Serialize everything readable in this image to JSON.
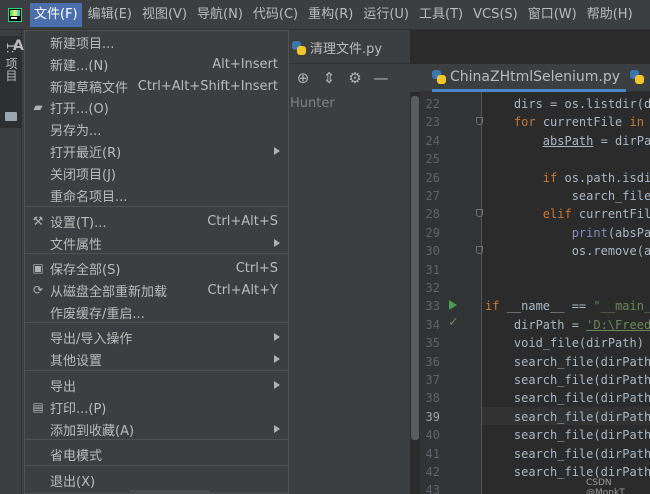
{
  "menubar": {
    "items": [
      "文件(F)",
      "编辑(E)",
      "视图(V)",
      "导航(N)",
      "代码(C)",
      "重构(R)",
      "运行(U)",
      "工具(T)",
      "VCS(S)",
      "窗口(W)",
      "帮助(H)"
    ],
    "active_index": 0
  },
  "toolwindow": {
    "strip_label": "1: 项目",
    "panel_title": "Ac",
    "tree_item": "Hunter"
  },
  "tabs": {
    "top_tab": "清理文件.py",
    "editor_tab": "ChinaZHtmlSelenium.py"
  },
  "file_menu": {
    "items": [
      {
        "label": "新建项目...",
        "shortcut": "",
        "submenu": false,
        "icon": ""
      },
      {
        "label": "新建...(N)",
        "shortcut": "Alt+Insert",
        "submenu": false,
        "icon": ""
      },
      {
        "label": "新建草稿文件",
        "shortcut": "Ctrl+Alt+Shift+Insert",
        "submenu": false,
        "icon": ""
      },
      {
        "label": "打开...(O)",
        "shortcut": "",
        "submenu": false,
        "icon": "folder-icon"
      },
      {
        "label": "另存为...",
        "shortcut": "",
        "submenu": false,
        "icon": ""
      },
      {
        "label": "打开最近(R)",
        "shortcut": "",
        "submenu": true,
        "icon": ""
      },
      {
        "label": "关闭项目(J)",
        "shortcut": "",
        "submenu": false,
        "icon": ""
      },
      {
        "label": "重命名项目...",
        "shortcut": "",
        "submenu": false,
        "icon": ""
      },
      {
        "label": "设置(T)...",
        "shortcut": "Ctrl+Alt+S",
        "submenu": false,
        "icon": "wrench-icon"
      },
      {
        "label": "文件属性",
        "shortcut": "",
        "submenu": true,
        "icon": ""
      },
      {
        "label": "保存全部(S)",
        "shortcut": "Ctrl+S",
        "submenu": false,
        "icon": "save-icon"
      },
      {
        "label": "从磁盘全部重新加载",
        "shortcut": "Ctrl+Alt+Y",
        "submenu": false,
        "icon": "reload-icon"
      },
      {
        "label": "作废缓存/重启...",
        "shortcut": "",
        "submenu": false,
        "icon": ""
      },
      {
        "label": "导出/导入操作",
        "shortcut": "",
        "submenu": true,
        "icon": ""
      },
      {
        "label": "其他设置",
        "shortcut": "",
        "submenu": true,
        "icon": ""
      },
      {
        "label": "导出",
        "shortcut": "",
        "submenu": true,
        "icon": ""
      },
      {
        "label": "打印...(P)",
        "shortcut": "",
        "submenu": false,
        "icon": "print-icon"
      },
      {
        "label": "添加到收藏(A)",
        "shortcut": "",
        "submenu": true,
        "icon": ""
      },
      {
        "label": "省电模式",
        "shortcut": "",
        "submenu": false,
        "icon": ""
      },
      {
        "label": "退出(X)",
        "shortcut": "",
        "submenu": false,
        "icon": ""
      }
    ]
  },
  "editor": {
    "line_numbers": [
      "22",
      "23",
      "24",
      "25",
      "26",
      "27",
      "28",
      "29",
      "30",
      "31",
      "32",
      "33",
      "34",
      "35",
      "36",
      "37",
      "38",
      "39",
      "40",
      "41",
      "42",
      "43"
    ],
    "current_line": "39",
    "lines": [
      {
        "indent": "    ",
        "segments": [
          [
            "",
            "dirs = os.listdir(di"
          ]
        ]
      },
      {
        "indent": "    ",
        "segments": [
          [
            "kw",
            "for "
          ],
          [
            "",
            "currentFile "
          ],
          [
            "kw",
            "in "
          ],
          [
            "",
            "c"
          ]
        ]
      },
      {
        "indent": "        ",
        "segments": [
          [
            "u",
            "absPath"
          ],
          [
            "",
            " = dirPat"
          ]
        ]
      },
      {
        "indent": "",
        "segments": [
          [
            "",
            ""
          ]
        ]
      },
      {
        "indent": "        ",
        "segments": [
          [
            "kw",
            "if "
          ],
          [
            "",
            "os.path.isdir"
          ]
        ]
      },
      {
        "indent": "            ",
        "segments": [
          [
            "",
            "search_file("
          ]
        ]
      },
      {
        "indent": "        ",
        "segments": [
          [
            "kw",
            "elif "
          ],
          [
            "",
            "currentFile"
          ]
        ]
      },
      {
        "indent": "            ",
        "segments": [
          [
            "fn",
            "print"
          ],
          [
            "",
            "(absPat"
          ]
        ]
      },
      {
        "indent": "            ",
        "segments": [
          [
            "",
            "os.remove(ab"
          ]
        ]
      },
      {
        "indent": "",
        "segments": [
          [
            "",
            ""
          ]
        ]
      },
      {
        "indent": "",
        "segments": [
          [
            "",
            ""
          ]
        ]
      },
      {
        "indent": "",
        "segments": [
          [
            "kw",
            "if "
          ],
          [
            "",
            "__name__ == "
          ],
          [
            "s",
            "\"__main__"
          ]
        ]
      },
      {
        "indent": "    ",
        "segments": [
          [
            "",
            "dirPath = "
          ],
          [
            "str",
            "'D:\\Freeda"
          ]
        ]
      },
      {
        "indent": "    ",
        "segments": [
          [
            "",
            "void_file(dirPath)"
          ]
        ]
      },
      {
        "indent": "    ",
        "segments": [
          [
            "",
            "search_file(dirPath,"
          ]
        ]
      },
      {
        "indent": "    ",
        "segments": [
          [
            "",
            "search_file(dirPath,"
          ]
        ]
      },
      {
        "indent": "    ",
        "segments": [
          [
            "",
            "search_file(dirPath,"
          ]
        ]
      },
      {
        "indent": "    ",
        "segments": [
          [
            "",
            "search_file(dirPath,"
          ]
        ]
      },
      {
        "indent": "    ",
        "segments": [
          [
            "",
            "search_file(dirPath,"
          ]
        ]
      },
      {
        "indent": "    ",
        "segments": [
          [
            "",
            "search_file(dirPath,"
          ]
        ]
      },
      {
        "indent": "    ",
        "segments": [
          [
            "",
            "search_file(dirPath,"
          ]
        ]
      },
      {
        "indent": "",
        "segments": [
          [
            "",
            ""
          ]
        ]
      }
    ]
  },
  "watermark": "CSDN @MonkT",
  "colors": {
    "menu_bg": "#3c3f41",
    "highlight": "#4b6eaf",
    "editor_bg": "#2b2b2b",
    "keyword": "#cc7832",
    "string": "#6a8759",
    "builtin": "#8888c6"
  }
}
